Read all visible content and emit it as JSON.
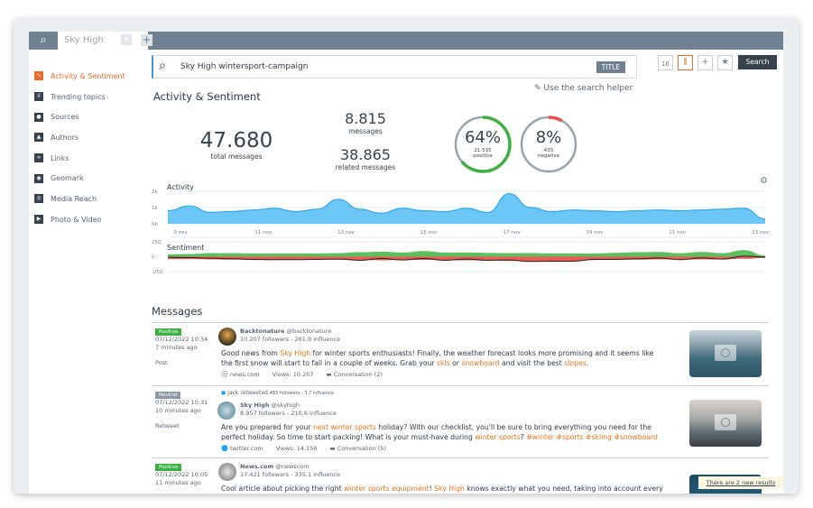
{
  "tabs": {
    "active_label": "Sky High",
    "close": "×",
    "add": "+",
    "search_icon": "search-icon"
  },
  "sidebar": {
    "items": [
      {
        "label": "Activity & Sentiment",
        "icon": "activity-icon",
        "glyph": "∿",
        "active": true
      },
      {
        "label": "Trending topics",
        "icon": "bar-chart-icon",
        "glyph": "ıl"
      },
      {
        "label": "Sources",
        "icon": "sources-icon",
        "glyph": "●"
      },
      {
        "label": "Authors",
        "icon": "user-icon",
        "glyph": "▲"
      },
      {
        "label": "Links",
        "icon": "link-icon",
        "glyph": "∞"
      },
      {
        "label": "Geomark",
        "icon": "map-pin-icon",
        "glyph": "◉"
      },
      {
        "label": "Media Reach",
        "icon": "eye-icon",
        "glyph": "◎"
      },
      {
        "label": "Photo & Video",
        "icon": "play-icon",
        "glyph": "▶"
      }
    ]
  },
  "search": {
    "query": "Sky High wintersport-campaign",
    "field_badge": "TITLE",
    "button": "Search",
    "calendar_day": "16",
    "helper": "Use the search helper"
  },
  "colors": {
    "accent": "#ef6b2a",
    "positive": "#3cb043",
    "negative": "#e84c4c",
    "activity": "#5bc0f8",
    "dark": "#37424d"
  },
  "overview": {
    "title": "Activity & Sentiment",
    "total": "47.680",
    "total_label": "total messages",
    "messages": "8.815",
    "messages_label": "messages",
    "related": "38.865",
    "related_label": "related messages",
    "positive": {
      "percent": "64%",
      "count": "21.535",
      "label": "positive",
      "fraction": 0.64
    },
    "negative": {
      "percent": "8%",
      "count": "435",
      "label": "negative",
      "fraction": 0.08
    }
  },
  "chart_data": [
    {
      "type": "area",
      "title": "Activity",
      "yticks": [
        "2k",
        "1k",
        "0k"
      ],
      "ylim": [
        0,
        2000
      ],
      "grid": true,
      "xticks": [
        "9 nov",
        "11 nov",
        "13 nov",
        "15 nov",
        "17 nov",
        "19 nov",
        "21 nov",
        "23 nov"
      ],
      "x_start": "2022-11-09",
      "x_end": "2022-11-23",
      "values": [
        800,
        1100,
        700,
        750,
        850,
        950,
        750,
        900,
        1500,
        900,
        650,
        950,
        800,
        750,
        950,
        700,
        1850,
        1000,
        750,
        850,
        800,
        750,
        800,
        850,
        800,
        850,
        900,
        950,
        300
      ]
    },
    {
      "type": "area",
      "title": "Sentiment",
      "yticks": [
        "250",
        "0",
        "-250"
      ],
      "ylim": [
        -250,
        250
      ],
      "grid": true,
      "x_start": "2022-11-09",
      "x_end": "2022-11-23",
      "series": [
        {
          "name": "positive",
          "color": "#5cc05f",
          "values": [
            40,
            45,
            60,
            60,
            55,
            55,
            55,
            55,
            60,
            75,
            85,
            70,
            95,
            70,
            70,
            65,
            60,
            60,
            55,
            55,
            55,
            65,
            75,
            80,
            60,
            80,
            60,
            110,
            20
          ]
        },
        {
          "name": "negative",
          "color": "#f05a55",
          "values": [
            -40,
            -40,
            -45,
            -50,
            -55,
            -55,
            -50,
            -50,
            -50,
            -55,
            -60,
            -55,
            -55,
            -60,
            -60,
            -65,
            -70,
            -75,
            -75,
            -70,
            -55,
            -50,
            -50,
            -45,
            -50,
            -45,
            -45,
            -35,
            -20
          ]
        },
        {
          "name": "net",
          "color": "#222",
          "values": [
            -10,
            -15,
            -25,
            -35,
            -45,
            -50,
            -50,
            -45,
            -40,
            -60,
            -30,
            -55,
            -30,
            -60,
            -40,
            -60,
            -55,
            -80,
            -75,
            -75,
            -45,
            -45,
            -35,
            -20,
            -50,
            -20,
            -40,
            10,
            -5
          ]
        }
      ]
    }
  ],
  "messages": {
    "title": "Messages",
    "new_results": "There are 2 new results",
    "items": [
      {
        "sentiment": "Positive",
        "sentiment_color": "#3cb043",
        "date": "07/12/2022 10:34",
        "ago": "7 minutes ago",
        "type": "Post",
        "author": "Backtonature",
        "handle": "@backtonature",
        "stats": "10.207 followers - 261,9 influence",
        "body": [
          {
            "t": "Good news from "
          },
          {
            "t": "Sky High",
            "hl": true
          },
          {
            "t": " for winter sports enthusiasts! Finally, the weather forecast looks more promising and it seems like the first snow will start to fall in a couple of weeks. Grab your "
          },
          {
            "t": "skis",
            "hl": true
          },
          {
            "t": " or "
          },
          {
            "t": "snowboard",
            "hl": true
          },
          {
            "t": " and visit the best "
          },
          {
            "t": "slopes",
            "hl": true
          },
          {
            "t": "."
          }
        ],
        "source": "news.com",
        "views": "Views: 10.207",
        "conversation": "Conversation (2)"
      },
      {
        "sentiment": "Neutral",
        "sentiment_color": "#8d99a4",
        "date": "07/12/2022 10:31",
        "ago": "10 minutes ago",
        "type": "Retweet",
        "retweet": "Jack retweeted",
        "retweet_stats": "482 followers - 3,7 influence",
        "author": "Sky High",
        "handle": "@skyhigh",
        "stats": "8.957 followers - 210,6 influence",
        "body": [
          {
            "t": "Are you prepared for your "
          },
          {
            "t": "next winter sports",
            "hl": true
          },
          {
            "t": " holiday? With our checklist, you'll be sure to bring everything you need for the perfect holiday. So time to start packing! What is your must-have during "
          },
          {
            "t": "winter sports",
            "hl": true
          },
          {
            "t": "? "
          },
          {
            "t": "#winter #sports #skiing #snowboard",
            "hl": true
          }
        ],
        "source": "twitter.com",
        "views": "Views: 14.156",
        "conversation": "Conversation (5)"
      },
      {
        "sentiment": "Positive",
        "sentiment_color": "#3cb043",
        "date": "07/12/2022 10:05",
        "ago": "11 minutes ago",
        "author": "News.com",
        "handle": "@newscom",
        "stats": "17.421 followers - 335,1 influence",
        "body": [
          {
            "t": "Cool article about picking the right "
          },
          {
            "t": "winter sports equipment",
            "hl": true
          },
          {
            "t": "! "
          },
          {
            "t": "Sky High",
            "hl": true
          },
          {
            "t": " knows exactly what you need, taking into account every level"
          }
        ]
      }
    ]
  }
}
